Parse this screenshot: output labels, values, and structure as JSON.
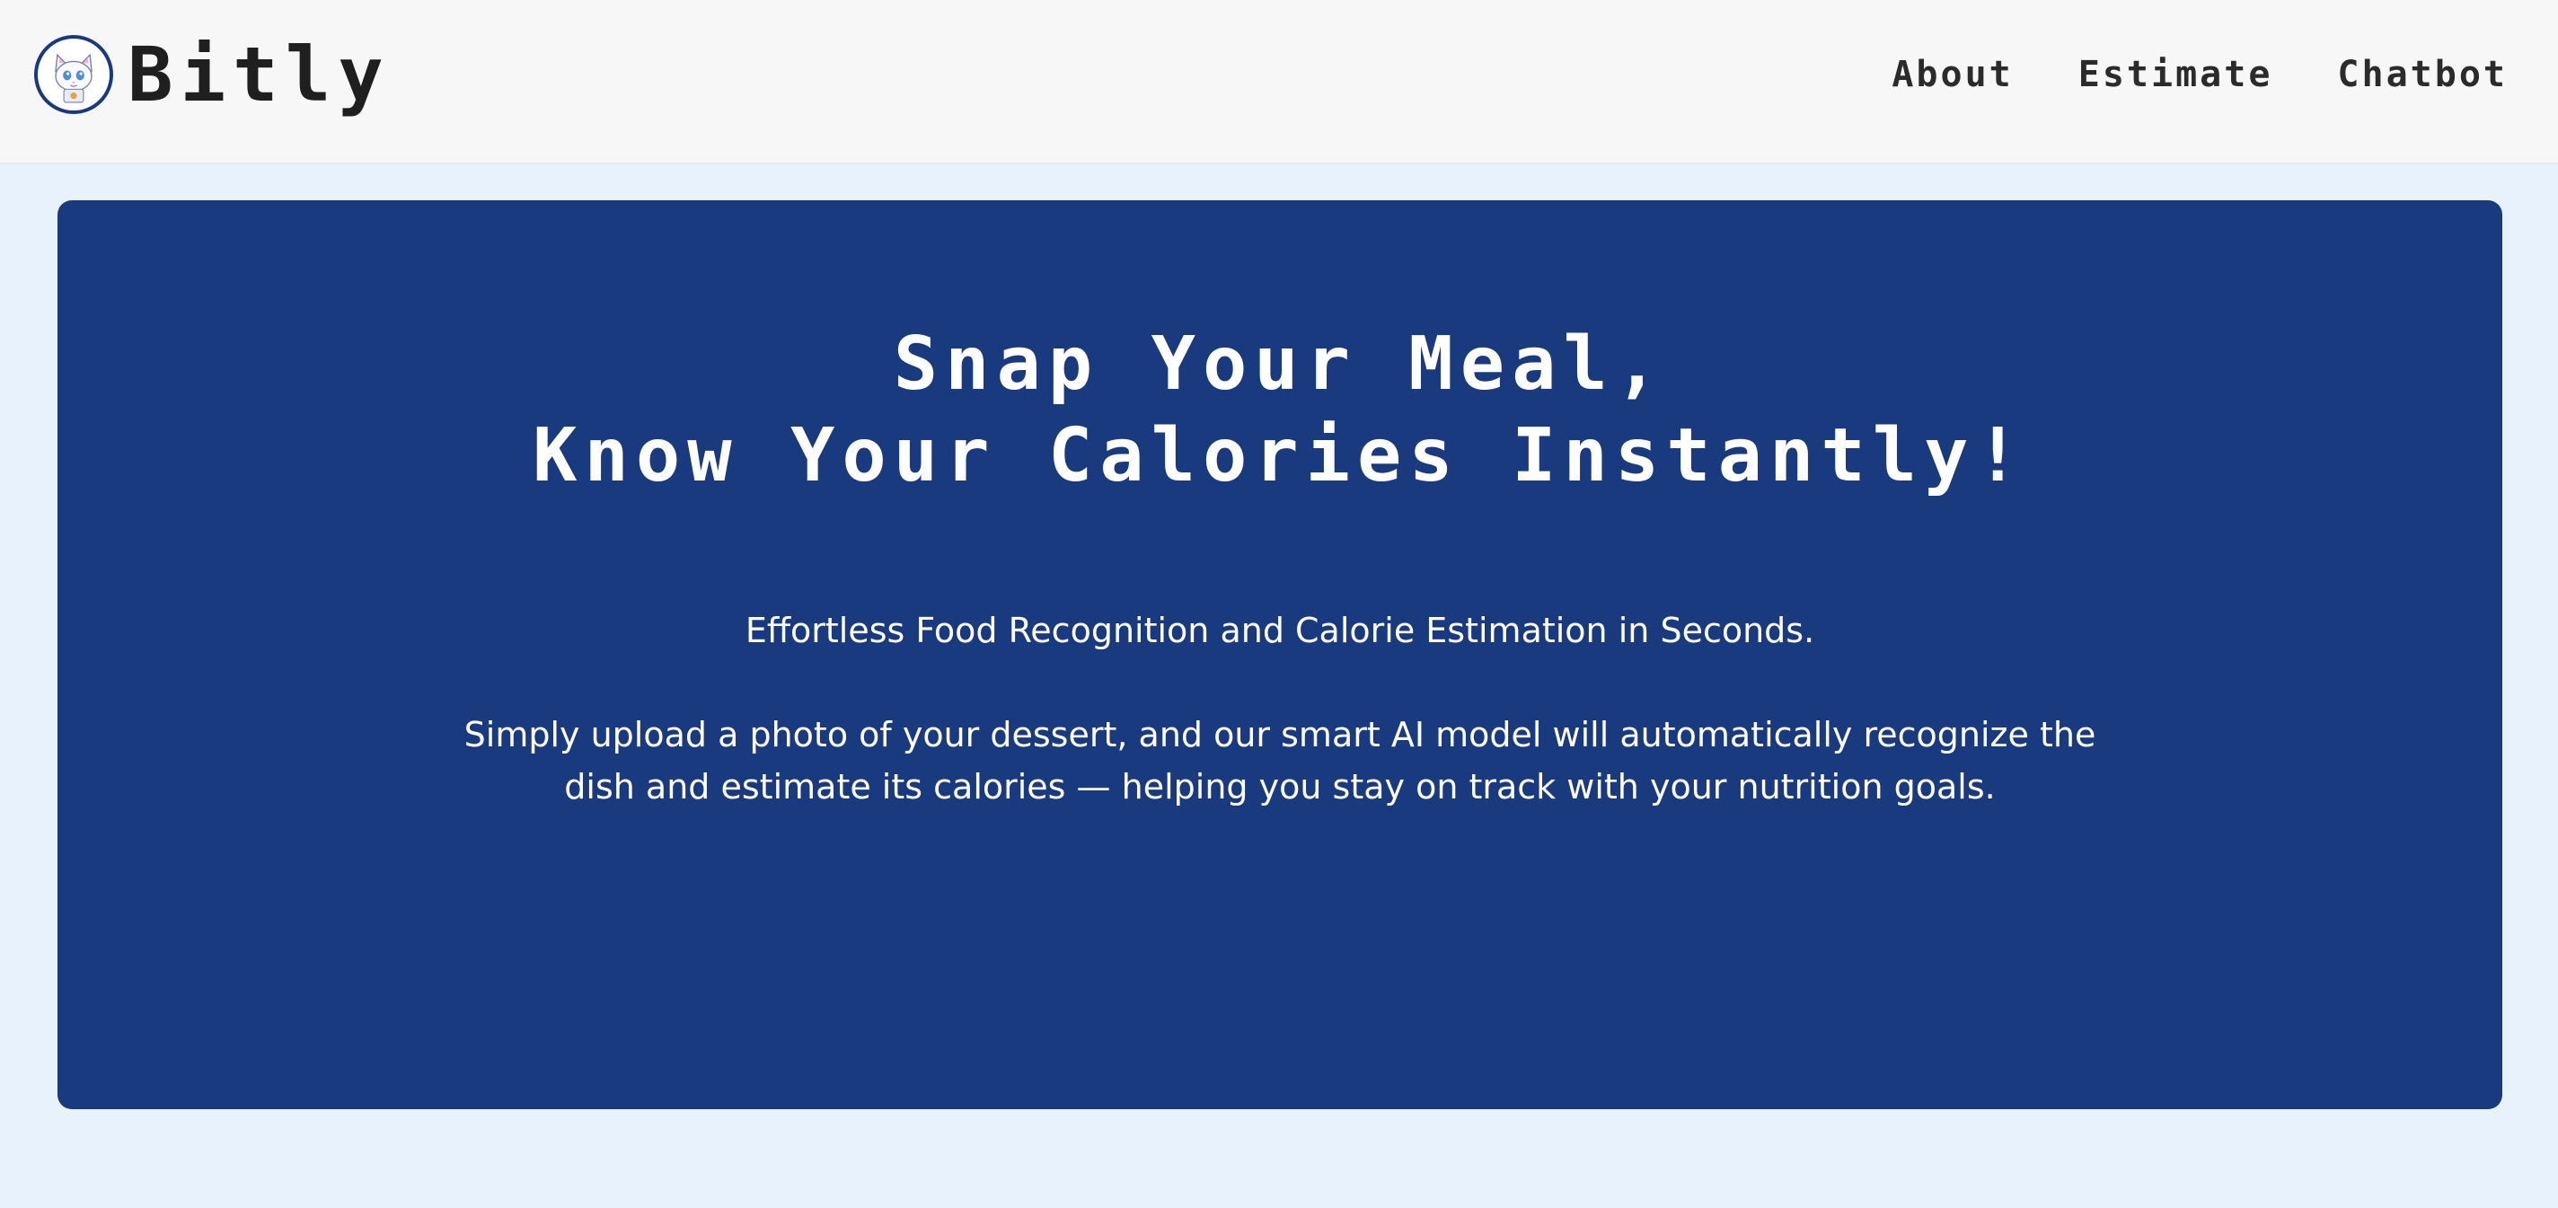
{
  "header": {
    "brand": "Bitly",
    "logo_icon": "cat-mascot-icon",
    "nav": {
      "about": "About",
      "estimate": "Estimate",
      "chatbot": "Chatbot"
    }
  },
  "hero": {
    "title_line1": "Snap Your Meal,",
    "title_line2": "Know Your Calories Instantly!",
    "subtitle": "Effortless Food Recognition and Calorie Estimation in Seconds.",
    "description": "Simply upload a photo of your dessert, and our smart AI model will automatically recognize the dish and estimate its calories — helping you stay on track with your nutrition goals."
  },
  "colors": {
    "page_bg": "#e8f2fd",
    "navbar_bg": "#f7f7f7",
    "hero_bg": "#1a3a80",
    "hero_text": "#ffffff",
    "brand_text": "#1f1f1f"
  }
}
